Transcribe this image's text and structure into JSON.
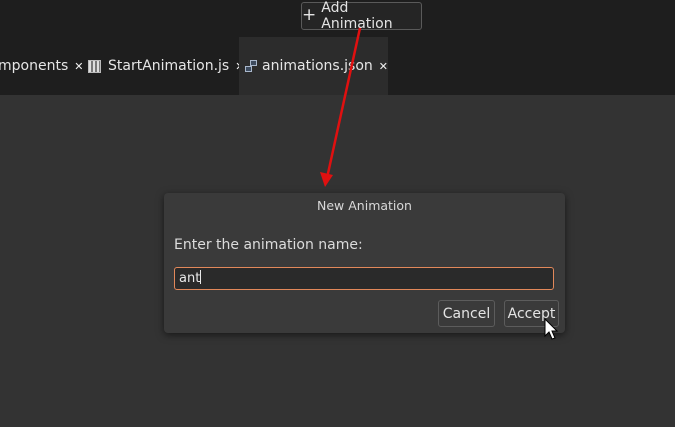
{
  "toolbar": {
    "add_animation_label": "Add Animation",
    "add_icon": "plus-icon"
  },
  "tabs": [
    {
      "label": "mponents",
      "close": "✕",
      "active": false
    },
    {
      "label": "StartAnimation.js",
      "close": "✕",
      "active": false,
      "icon": "js-file-icon"
    },
    {
      "label": "animations.json",
      "close": "✕",
      "active": true,
      "icon": "json-file-icon"
    }
  ],
  "dialog": {
    "title": "New Animation",
    "prompt": "Enter the animation name:",
    "input_value": "ant",
    "cancel_label": "Cancel",
    "accept_label": "Accept"
  },
  "colors": {
    "annotation_arrow": "#e01010",
    "input_focus_border": "#e2885a"
  }
}
